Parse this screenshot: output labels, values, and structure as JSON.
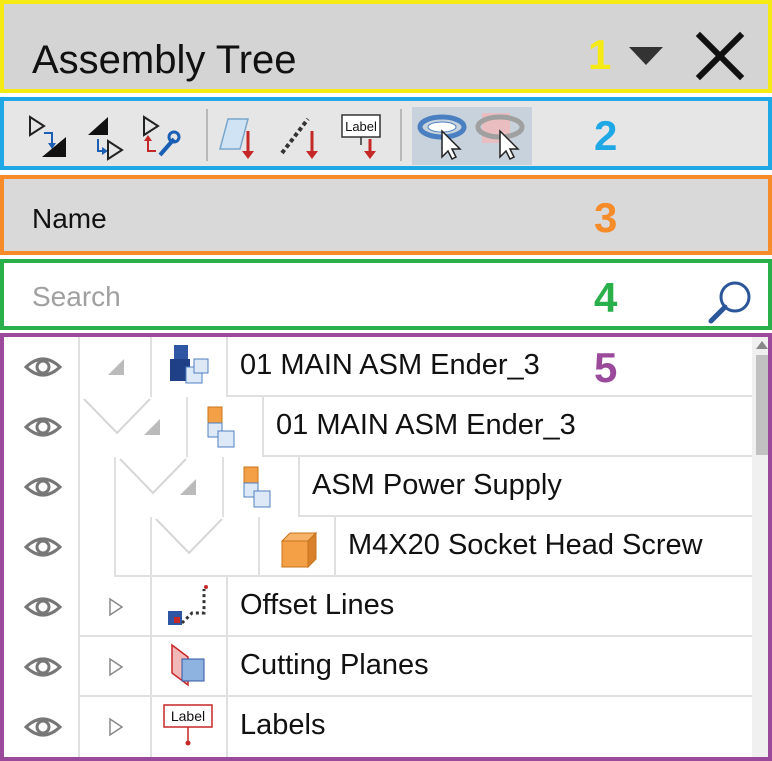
{
  "header": {
    "title": "Assembly Tree",
    "callout": "1",
    "callout_color": "#f5ea14"
  },
  "toolbar": {
    "callout": "2",
    "callout_color": "#1ea8e6",
    "buttons": [
      {
        "icon": "select-child-icon"
      },
      {
        "icon": "select-parent-icon"
      },
      {
        "icon": "select-properties-icon"
      },
      {
        "icon": "drop-plane-icon"
      },
      {
        "icon": "drop-offset-line-icon"
      },
      {
        "icon": "drop-label-icon",
        "text": "Label"
      },
      {
        "icon": "highlight-mode-icon"
      },
      {
        "icon": "highlight-section-icon"
      }
    ]
  },
  "column": {
    "name_label": "Name",
    "callout": "3",
    "callout_color": "#f68b2a"
  },
  "search": {
    "placeholder": "Search",
    "callout": "4",
    "callout_color": "#2ab04a"
  },
  "tree": {
    "callout": "5",
    "callout_color": "#9b4a9b",
    "rows": [
      {
        "label": "01 MAIN ASM Ender_3",
        "icon": "assembly-blue-icon",
        "expanded": true
      },
      {
        "label": "01 MAIN ASM Ender_3",
        "icon": "subassembly-orange-icon",
        "expanded": true
      },
      {
        "label": "ASM Power Supply",
        "icon": "subassembly-orange-icon",
        "expanded": true
      },
      {
        "label": "M4X20 Socket Head Screw",
        "icon": "part-orange-icon"
      },
      {
        "label": "Offset Lines",
        "icon": "offset-lines-icon",
        "expanded": false
      },
      {
        "label": "Cutting Planes",
        "icon": "cutting-planes-icon",
        "expanded": false
      },
      {
        "label": "Labels",
        "icon": "labels-icon",
        "icon_text": "Label",
        "expanded": false
      }
    ]
  }
}
